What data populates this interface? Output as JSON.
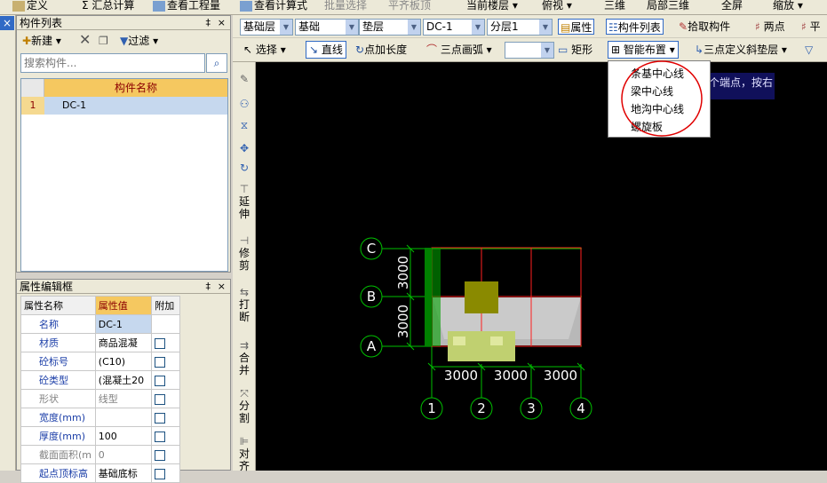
{
  "top_menu": {
    "items": [
      "定义",
      "汇总计算",
      "查看工程量",
      "查看计算式",
      "批量选择",
      "平齐板顶",
      "当前楼层",
      "俯视",
      "三维",
      "局部三维",
      "全屏",
      "缩放"
    ]
  },
  "left_strip": {
    "close_glyph": "×"
  },
  "component_list": {
    "title": "构件列表",
    "pin_glyph": "‡",
    "close_glyph": "×",
    "new_label": "新建",
    "filter_label": "过滤",
    "search_placeholder": "搜索构件...",
    "column_header": "构件名称",
    "rows": [
      {
        "index": "1",
        "name": "DC-1"
      }
    ]
  },
  "property_editor": {
    "title": "属性编辑框",
    "pin_glyph": "‡",
    "close_glyph": "×",
    "headers": [
      "属性名称",
      "属性值",
      "附加"
    ],
    "rows": [
      {
        "name": "名称",
        "value": "DC-1",
        "blue": true,
        "check": false
      },
      {
        "name": "材质",
        "value": "商品混凝",
        "blue": true,
        "check": true
      },
      {
        "name": "砼标号",
        "value": "(C10)",
        "blue": true,
        "check": true
      },
      {
        "name": "砼类型",
        "value": "(混凝土20",
        "blue": true,
        "check": true
      },
      {
        "name": "形状",
        "value": "线型",
        "blue": false,
        "check": true
      },
      {
        "name": "宽度(mm)",
        "value": "",
        "blue": true,
        "check": true
      },
      {
        "name": "厚度(mm)",
        "value": "100",
        "blue": true,
        "check": true
      },
      {
        "name": "截面面积(m",
        "value": "0",
        "blue": false,
        "check": true
      },
      {
        "name": "起点顶标高",
        "value": "基础底标",
        "blue": true,
        "check": true
      }
    ]
  },
  "toolbar1": {
    "combos": [
      "基础层",
      "基础",
      "垫层",
      "DC-1",
      "分层1"
    ],
    "property_label": "属性",
    "component_list_label": "构件列表",
    "pick_component_label": "拾取构件",
    "two_points_label": "两点",
    "parallel_label": "平"
  },
  "toolbar2": {
    "select_label": "选择",
    "line_label": "直线",
    "point_length_label": "点加长度",
    "three_point_arc_label": "三点画弧",
    "rect_label": "矩形",
    "smart_layout_label": "智能布置",
    "three_point_slope_label": "三点定义斜垫层"
  },
  "vertical_toolbar": {
    "extend_label": "延伸",
    "trim_label": "修剪",
    "break_label": "打断",
    "merge_label": "合并",
    "split_label": "分割",
    "align_label": "对齐"
  },
  "dropdown": {
    "items": [
      "条基中心线",
      "梁中心线",
      "地沟中心线",
      "螺旋板"
    ]
  },
  "tooltip": {
    "text": "个端点，按右"
  },
  "drawing": {
    "row_axes": [
      "C",
      "B",
      "A"
    ],
    "col_axes": [
      "1",
      "2",
      "3",
      "4"
    ],
    "row_spacings": [
      "3000",
      "3000"
    ],
    "col_spacings": [
      "3000",
      "3000",
      "3000"
    ]
  },
  "colors": {
    "axis_line": "#00c000",
    "grid_red": "#ff2020",
    "slab_gray": "#b8b8b8",
    "column_olive": "#8a8a00",
    "pad_lime": "#c0d070",
    "wall_green": "#008000",
    "highlight_circle": "#e00000"
  }
}
